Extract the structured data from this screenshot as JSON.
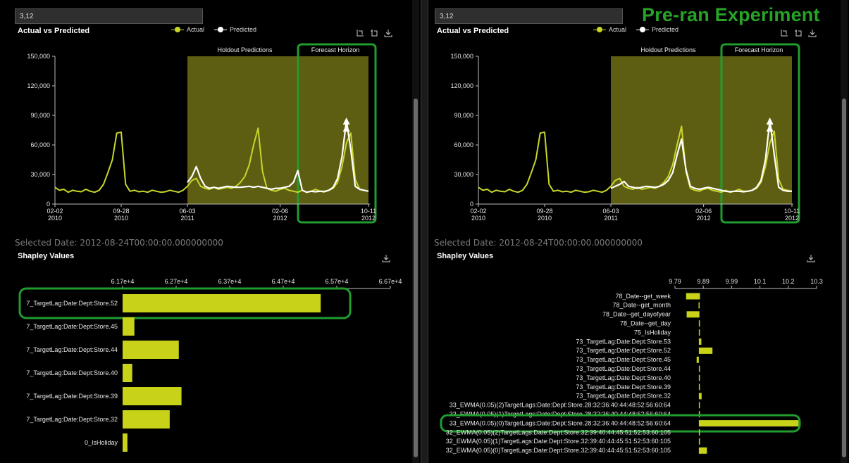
{
  "banner": "Pre-ran Experiment",
  "colors": {
    "actual": "#c8d62a",
    "predicted": "#ffffff",
    "band": "#6e6e16",
    "highlight": "#1f9d2f",
    "bar": "#c7d219"
  },
  "icons": [
    "zoom-icon",
    "reset-icon",
    "download-icon"
  ],
  "left": {
    "search_value": "3,12",
    "chart_title": "Actual vs Predicted",
    "legend": {
      "actual": "Actual",
      "predicted": "Predicted"
    },
    "band_labels": {
      "holdout": "Holdout Predictions",
      "forecast": "Forecast Horizon"
    },
    "selected_date": "Selected Date: 2012-08-24T00:00:00.000000000",
    "shap_title": "Shapley Values"
  },
  "right": {
    "search_value": "3,12",
    "chart_title": "Actual vs Predicted",
    "legend": {
      "actual": "Actual",
      "predicted": "Predicted"
    },
    "band_labels": {
      "holdout": "Holdout Predictions",
      "forecast": "Forecast Horizon"
    },
    "selected_date": "Selected Date: 2012-08-24T00:00:00.000000000",
    "shap_title": "Shapley Values"
  },
  "chart_data": [
    {
      "type": "line",
      "title": "Actual vs Predicted",
      "y_ticks": [
        "150,000",
        "120,000",
        "90,000",
        "60,000",
        "30,000",
        "0"
      ],
      "x_ticks": [
        [
          "02-02",
          "2010"
        ],
        [
          "09-28",
          "2010"
        ],
        [
          "06-03",
          "2011"
        ],
        [
          "02-06",
          "2012"
        ],
        [
          "10-11",
          "2012"
        ]
      ],
      "ylim": [
        0,
        150000
      ],
      "series": [
        {
          "name": "Actual",
          "values": [
            17000,
            14000,
            15000,
            12000,
            14000,
            13000,
            12500,
            15000,
            13000,
            12000,
            14000,
            20000,
            32000,
            45000,
            72000,
            73000,
            20000,
            13000,
            14000,
            12500,
            13000,
            12000,
            14000,
            13000,
            12000,
            12500,
            14000,
            13000,
            12000,
            14000,
            18000,
            24000,
            26000,
            18000,
            16000,
            15000,
            17000,
            15000,
            16000,
            17000,
            16000,
            18000,
            22000,
            28000,
            40000,
            60000,
            77000,
            33000,
            16000,
            14000,
            13000,
            15000,
            16000,
            14000,
            13000,
            12000,
            14000,
            12000,
            13000,
            15000,
            13000,
            13000,
            14000,
            16000,
            22000,
            38000,
            62000,
            72000,
            25000,
            15000,
            14000,
            13000
          ]
        },
        {
          "name": "Predicted",
          "values": [
            null,
            null,
            null,
            null,
            null,
            null,
            null,
            null,
            null,
            null,
            null,
            null,
            null,
            null,
            null,
            null,
            null,
            null,
            null,
            null,
            null,
            null,
            null,
            null,
            null,
            null,
            null,
            null,
            null,
            null,
            22000,
            28000,
            38000,
            26000,
            18000,
            16000,
            17000,
            16000,
            17000,
            18000,
            17500,
            17000,
            17000,
            17500,
            18000,
            17000,
            18000,
            17000,
            16000,
            15000,
            16000,
            16000,
            17000,
            18000,
            22000,
            34000,
            14000,
            12000,
            13000,
            12500,
            13000,
            12500,
            14000,
            17000,
            26000,
            48000,
            85000,
            55000,
            18000,
            15000,
            14000,
            13000
          ]
        }
      ],
      "bands": [
        {
          "label": "Holdout Predictions",
          "from_index": 30,
          "to_index": 56
        },
        {
          "label": "Forecast Horizon",
          "from_index": 56,
          "to_index": 71
        }
      ]
    },
    {
      "type": "line",
      "title": "Actual vs Predicted",
      "y_ticks": [
        "150,000",
        "120,000",
        "90,000",
        "60,000",
        "30,000",
        "0"
      ],
      "x_ticks": [
        [
          "02-02",
          "2010"
        ],
        [
          "09-28",
          "2010"
        ],
        [
          "06-03",
          "2011"
        ],
        [
          "02-06",
          "2012"
        ],
        [
          "10-11",
          "2012"
        ]
      ],
      "ylim": [
        0,
        150000
      ],
      "series": [
        {
          "name": "Actual",
          "values": [
            17000,
            14000,
            15000,
            12000,
            14000,
            13000,
            12500,
            15000,
            13000,
            12000,
            14000,
            20000,
            32000,
            45000,
            72000,
            73000,
            20000,
            13000,
            14000,
            12500,
            13000,
            12000,
            14000,
            13000,
            12000,
            12500,
            14000,
            13000,
            12000,
            14000,
            18000,
            24000,
            26000,
            18000,
            16000,
            15000,
            17000,
            15000,
            16000,
            17000,
            16000,
            18000,
            22000,
            28000,
            40000,
            60000,
            79000,
            33000,
            16000,
            14000,
            13000,
            15000,
            16000,
            14000,
            13000,
            12000,
            14000,
            12000,
            13000,
            15000,
            13000,
            13000,
            14000,
            16000,
            22000,
            38000,
            62000,
            74000,
            25000,
            15000,
            14000,
            13000
          ]
        },
        {
          "name": "Predicted",
          "values": [
            null,
            null,
            null,
            null,
            null,
            null,
            null,
            null,
            null,
            null,
            null,
            null,
            null,
            null,
            null,
            null,
            null,
            null,
            null,
            null,
            null,
            null,
            null,
            null,
            null,
            null,
            null,
            null,
            null,
            null,
            16000,
            18000,
            20000,
            23000,
            18000,
            17000,
            16000,
            17000,
            18000,
            17500,
            17000,
            18000,
            20000,
            24000,
            32000,
            50000,
            66000,
            35000,
            18000,
            16000,
            15000,
            16000,
            17000,
            16000,
            15000,
            14000,
            13000,
            12500,
            13000,
            13000,
            12500,
            13000,
            14000,
            17000,
            24000,
            45000,
            85000,
            50000,
            17000,
            14000,
            13000,
            13000
          ]
        }
      ],
      "bands": [
        {
          "label": "Holdout Predictions",
          "from_index": 30,
          "to_index": 56
        },
        {
          "label": "Forecast Horizon",
          "from_index": 56,
          "to_index": 71
        }
      ]
    },
    {
      "type": "bar",
      "orientation": "horizontal",
      "title": "Shapley Values",
      "ticks": [
        "6.17e+4",
        "6.27e+4",
        "6.37e+4",
        "6.47e+4",
        "6.57e+4",
        "6.67e+4"
      ],
      "xlim": [
        61700,
        66700
      ],
      "categories": [
        "7_TargetLag:Date:Dept:Store.52",
        "7_TargetLag:Date:Dept:Store.45",
        "7_TargetLag:Date:Dept:Store.44",
        "7_TargetLag:Date:Dept:Store.40",
        "7_TargetLag:Date:Dept:Store.39",
        "7_TargetLag:Date:Dept:Store.32",
        "0_IsHoliday"
      ],
      "bars": [
        [
          61700,
          65400
        ],
        [
          61700,
          61920
        ],
        [
          61700,
          62750
        ],
        [
          61700,
          61880
        ],
        [
          61700,
          62800
        ],
        [
          61700,
          62580
        ],
        [
          61700,
          61790
        ]
      ],
      "highlighted": "7_TargetLag:Date:Dept:Store.52"
    },
    {
      "type": "bar",
      "orientation": "horizontal",
      "title": "Shapley Values",
      "ticks": [
        "9.79",
        "9.89",
        "9.99",
        "10.1",
        "10.2",
        "10.3"
      ],
      "xlim": [
        9.79,
        10.3
      ],
      "categories": [
        "78_Date--get_week",
        "78_Date--get_month",
        "78_Date--get_dayofyear",
        "78_Date--get_day",
        "75_IsHoliday",
        "73_TargetLag:Date:Dept:Store.53",
        "73_TargetLag:Date:Dept:Store.52",
        "73_TargetLag:Date:Dept:Store.45",
        "73_TargetLag:Date:Dept:Store.44",
        "73_TargetLag:Date:Dept:Store.40",
        "73_TargetLag:Date:Dept:Store.39",
        "73_TargetLag:Date:Dept:Store.32",
        "33_EWMA(0.05)(2)TargetLags:Date:Dept:Store.28:32:36:40:44:48:52:56:60:64",
        "33_EWMA(0.05)(1)TargetLags:Date:Dept:Store.28:32:36:40:44:48:52:56:60:64",
        "33_EWMA(0.05)(0)TargetLags:Date:Dept:Store.28:32:36:40:44:48:52:56:60:64",
        "32_EWMA(0.05)(2)TargetLags:Date:Dept:Store.32:39:40:44:45:51:52:53:60:105",
        "32_EWMA(0.05)(1)TargetLags:Date:Dept:Store.32:39:40:44:45:51:52:53:60:105",
        "32_EWMA(0.05)(0)TargetLags:Date:Dept:Store.32:39:40:44:45:51:52:53:60:105"
      ],
      "bars": [
        [
          9.83,
          9.88
        ],
        [
          9.875,
          9.878
        ],
        [
          9.832,
          9.878
        ],
        [
          9.876,
          9.878
        ],
        [
          9.876,
          9.877
        ],
        [
          9.876,
          9.885
        ],
        [
          9.876,
          9.925
        ],
        [
          9.868,
          9.876
        ],
        [
          9.876,
          9.877
        ],
        [
          9.876,
          9.877
        ],
        [
          9.876,
          9.877
        ],
        [
          9.876,
          9.886
        ],
        [
          9.876,
          9.878
        ],
        [
          9.876,
          9.878
        ],
        [
          9.876,
          10.235
        ],
        [
          9.876,
          9.878
        ],
        [
          9.876,
          9.88
        ],
        [
          9.876,
          9.905
        ]
      ],
      "highlighted": "33_EWMA(0.05)(0)TargetLags:Date:Dept:Store.28:32:36:40:44:48:52:56:60:64"
    }
  ]
}
